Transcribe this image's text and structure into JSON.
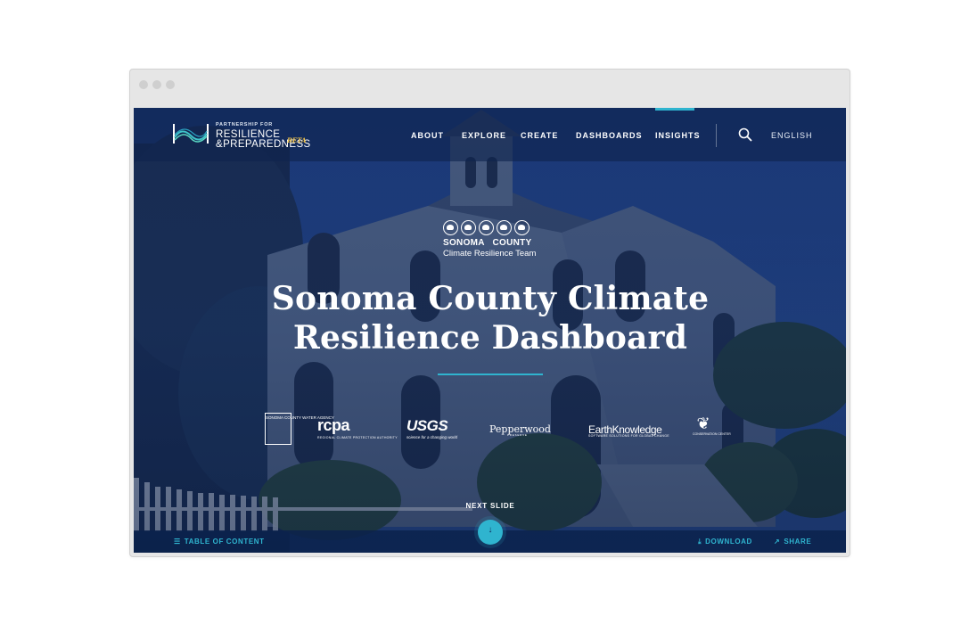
{
  "header": {
    "logo": {
      "line_small": "PARTNERSHIP FOR",
      "line_1": "RESILIENCE",
      "line_2": "&PREPAREDNESS",
      "beta": "BETA"
    },
    "nav": [
      {
        "label": "ABOUT"
      },
      {
        "label": "EXPLORE"
      },
      {
        "label": "CREATE"
      },
      {
        "label": "DASHBOARDS"
      },
      {
        "label": "INSIGHTS"
      }
    ],
    "active_nav": "INSIGHTS",
    "language": "ENGLISH"
  },
  "hero": {
    "team_logo": {
      "name": "SONOMA COUNTY",
      "subtitle": "Climate Resilience Team"
    },
    "title": "Sonoma County Climate Resilience Dashboard"
  },
  "partners": {
    "scwa": "SONOMA COUNTY WATER AGENCY",
    "rcpa": {
      "name": "rcpa",
      "sub": "REGIONAL CLIMATE PROTECTION AUTHORITY"
    },
    "usgs": {
      "name": "USGS",
      "sub": "science for a changing world"
    },
    "pepperwood": {
      "name": "Pepperwood",
      "sub": "PRESERVE"
    },
    "earthknowledge": {
      "name": "EarthKnowledge",
      "sub": "SOFTWARE SOLUTIONS FOR GLOBAL CHANGE"
    },
    "leaf": "CONSERVATION CENTER"
  },
  "footer": {
    "next_slide": "NEXT SLIDE",
    "table_of_content": "TABLE OF CONTENT",
    "download": "DOWNLOAD",
    "share": "SHARE"
  },
  "colors": {
    "accent": "#2fb4cf",
    "header_bg": "#0e244e",
    "beta": "#f1c34a"
  }
}
